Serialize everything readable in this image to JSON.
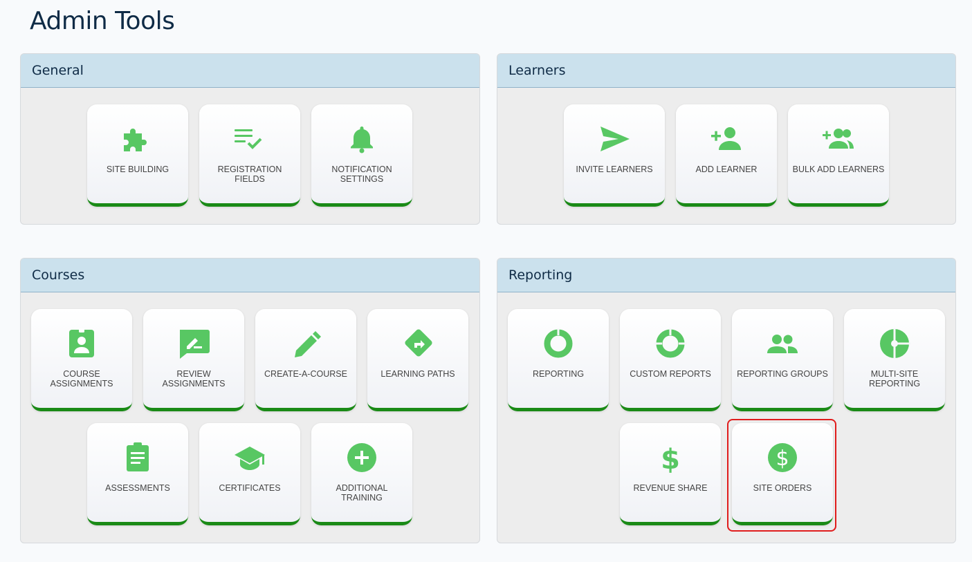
{
  "page": {
    "title": "Admin Tools"
  },
  "colors": {
    "accent_green": "#58c763",
    "tile_border": "#1a8a16",
    "header_bg": "#cbe1ed",
    "highlight": "#e01c1c"
  },
  "panels": {
    "general": {
      "title": "General",
      "tiles": [
        {
          "label": "Site Building",
          "icon": "puzzle-icon"
        },
        {
          "label": "Registration Fields",
          "icon": "checklist-icon"
        },
        {
          "label": "Notification Settings",
          "icon": "bell-icon"
        }
      ]
    },
    "learners": {
      "title": "Learners",
      "tiles": [
        {
          "label": "Invite Learners",
          "icon": "send-icon"
        },
        {
          "label": "Add Learner",
          "icon": "person-add-icon"
        },
        {
          "label": "Bulk Add Learners",
          "icon": "group-add-icon"
        }
      ]
    },
    "courses": {
      "title": "Courses",
      "tiles": [
        {
          "label": "Course Assignments",
          "icon": "badge-icon"
        },
        {
          "label": "Review Assignments",
          "icon": "rate-review-icon"
        },
        {
          "label": "Create-A-Course",
          "icon": "pencil-icon"
        },
        {
          "label": "Learning Paths",
          "icon": "directions-icon"
        },
        {
          "label": "Assessments",
          "icon": "clipboard-icon"
        },
        {
          "label": "Certificates",
          "icon": "graduation-cap-icon"
        },
        {
          "label": "Additional Training",
          "icon": "plus-circle-icon"
        }
      ]
    },
    "reporting": {
      "title": "Reporting",
      "tiles": [
        {
          "label": "Reporting",
          "icon": "donut-icon"
        },
        {
          "label": "Custom Reports",
          "icon": "segmented-donut-icon"
        },
        {
          "label": "Reporting Groups",
          "icon": "people-icon"
        },
        {
          "label": "Multi-Site Reporting",
          "icon": "pie-icon"
        },
        {
          "label": "Revenue Share",
          "icon": "dollar-icon"
        },
        {
          "label": "Site Orders",
          "icon": "dollar-circle-icon"
        }
      ]
    }
  }
}
